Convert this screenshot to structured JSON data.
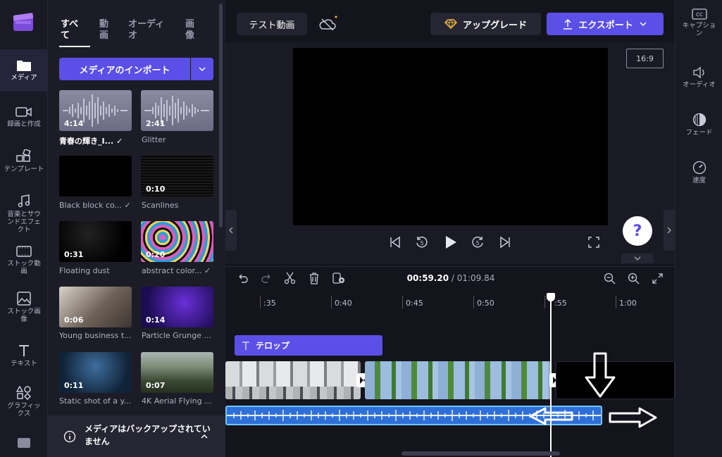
{
  "rail": {
    "items": [
      {
        "label": "メディア",
        "icon": "folder-icon"
      },
      {
        "label": "録画と作成",
        "icon": "camera-icon"
      },
      {
        "label": "テンプレート",
        "icon": "template-icon"
      },
      {
        "label": "音楽とサウンドエフェクト",
        "icon": "music-icon"
      },
      {
        "label": "ストック動画",
        "icon": "film-icon"
      },
      {
        "label": "ストック画像",
        "icon": "image-icon"
      },
      {
        "label": "テキスト",
        "icon": "text-icon"
      },
      {
        "label": "グラフィックス",
        "icon": "shapes-icon"
      }
    ]
  },
  "media_panel": {
    "tabs": [
      "すべて",
      "動画",
      "オーディオ",
      "画像"
    ],
    "import_label": "メディアのインポート",
    "items": [
      {
        "caption": "青春の輝き_I...",
        "duration": "4:14",
        "checked": true
      },
      {
        "caption": "Glitter",
        "duration": "2:41",
        "checked": false
      },
      {
        "caption": "Black block co...",
        "duration": "",
        "checked": true
      },
      {
        "caption": "Scanlines",
        "duration": "0:10",
        "checked": false
      },
      {
        "caption": "Floating dust",
        "duration": "0:31",
        "checked": false
      },
      {
        "caption": "abstract color...",
        "duration": "0:20",
        "checked": true
      },
      {
        "caption": "Young business t...",
        "duration": "0:06",
        "checked": false
      },
      {
        "caption": "Particle Grunge ...",
        "duration": "0:14",
        "checked": false
      },
      {
        "caption": "Static shot of a y...",
        "duration": "0:11",
        "checked": false
      },
      {
        "caption": "4K Aerial Flying ...",
        "duration": "0:07",
        "checked": false
      }
    ],
    "backup_text": "メディアはバックアップされていません"
  },
  "topbar": {
    "project_title": "テスト動画",
    "upgrade_label": "アップグレード",
    "export_label": "エクスポート"
  },
  "preview": {
    "aspect_ratio": "16:9",
    "help_label": "?"
  },
  "right_rail": {
    "items": [
      {
        "label": "キャプション",
        "icon": "cc-icon"
      },
      {
        "label": "オーディオ",
        "icon": "speaker-icon"
      },
      {
        "label": "フェード",
        "icon": "fade-icon"
      },
      {
        "label": "速度",
        "icon": "speedometer-icon"
      }
    ]
  },
  "timeline": {
    "current_time": "00:59.20",
    "separator": " / ",
    "total_time": "01:09.84",
    "ticks": [
      ":35",
      "0:40",
      "0:45",
      "0:50",
      ":55",
      "1:00"
    ],
    "caption_clip_label": "テロップ"
  },
  "colors": {
    "accent": "#5a4fe6",
    "audio_clip": "#2f6fd8",
    "audio_border": "#6ec5ff"
  }
}
